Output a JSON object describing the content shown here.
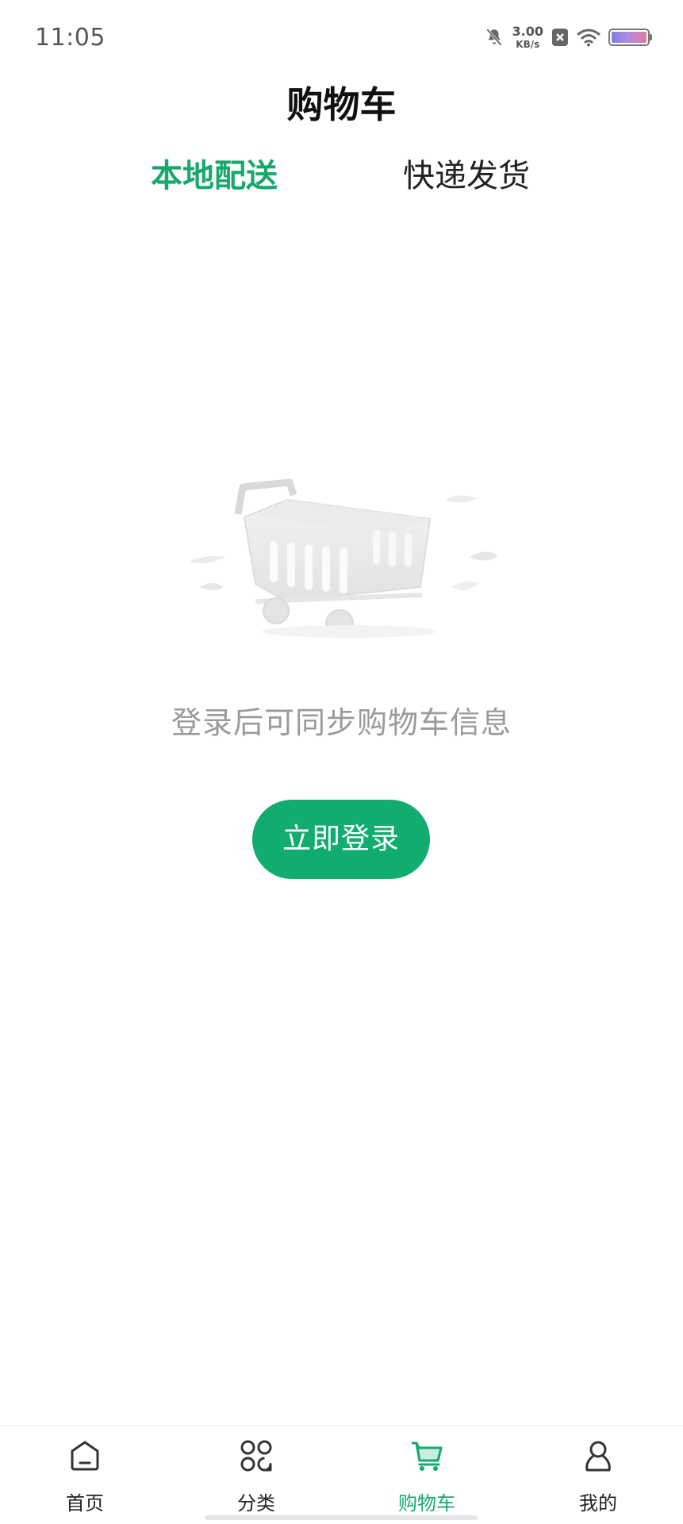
{
  "status_bar": {
    "time": "11:05",
    "net_speed_value": "3.00",
    "net_speed_unit": "KB/s",
    "icons": [
      "mute-icon",
      "no-sim-icon",
      "wifi-icon",
      "battery-icon"
    ],
    "battery_level": 1.0
  },
  "header": {
    "title": "购物车"
  },
  "tabs": [
    {
      "label": "本地配送",
      "active": true
    },
    {
      "label": "快递发货",
      "active": false
    }
  ],
  "empty_state": {
    "illustration": "empty-cart-illustration",
    "message": "登录后可同步购物车信息",
    "button_label": "立即登录"
  },
  "bottom_nav": {
    "items": [
      {
        "label": "首页",
        "icon": "home-icon",
        "active": false
      },
      {
        "label": "分类",
        "icon": "category-icon",
        "active": false
      },
      {
        "label": "购物车",
        "icon": "cart-icon",
        "active": true
      },
      {
        "label": "我的",
        "icon": "profile-icon",
        "active": false
      }
    ]
  },
  "colors": {
    "accent": "#17a96b",
    "button": "#10ad6f",
    "muted_text": "#9a9a9a"
  }
}
